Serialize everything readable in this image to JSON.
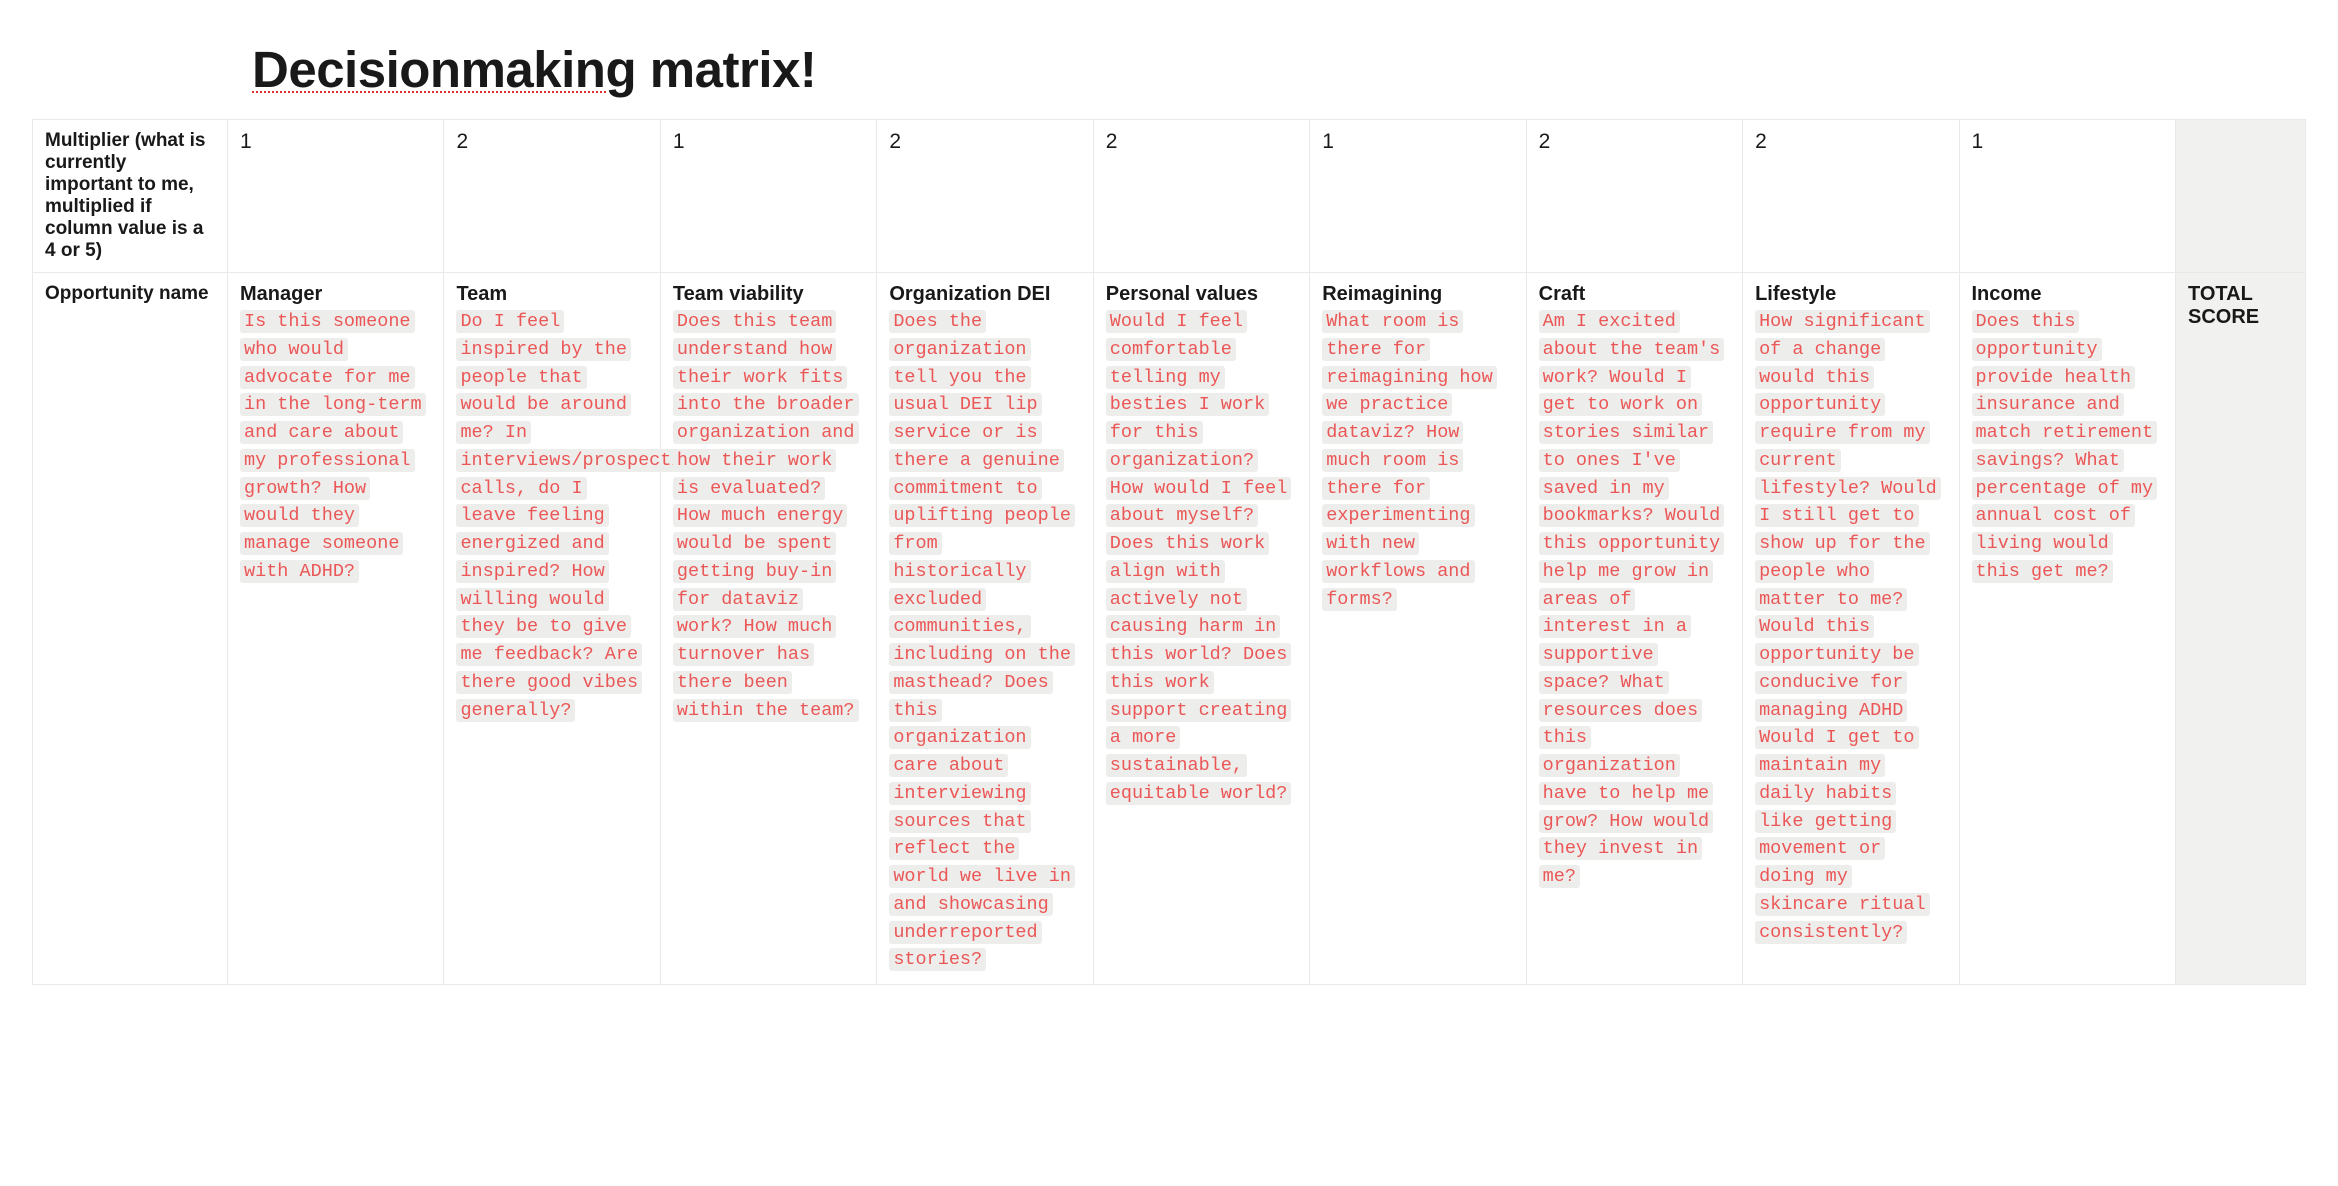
{
  "title_parts": {
    "misspelled": "Decisionmaking",
    "rest": " matrix!"
  },
  "row1_label": "Multiplier (what is currently important to me, multiplied if column value is a 4 or 5)",
  "row2_label": "Opportunity name",
  "total_label": "TOTAL SCORE",
  "columns": [
    {
      "mult": "1",
      "name": "Manager",
      "desc": "Is this someone who would advocate for me in the long-term and care about my professional growth? How would they manage someone with ADHD?"
    },
    {
      "mult": "2",
      "name": "Team",
      "desc": "Do I feel inspired by the people that would be around me? In interviews/prospective calls, do I leave feeling energized and inspired? How willing would they be to give me feedback? Are there good vibes generally?"
    },
    {
      "mult": "1",
      "name": "Team viability",
      "desc": "Does this team understand how their work fits into the broader organization and how their work is evaluated? How much energy would be spent getting buy-in for dataviz work? How much turnover has there been within the team?"
    },
    {
      "mult": "2",
      "name": "Organization DEI",
      "desc": "Does the organization tell you the usual DEI lip service or is there a genuine commitment to uplifting people from historically excluded communities, including on the masthead? Does this organization care about interviewing sources that reflect the world we live in and showcasing underreported stories?"
    },
    {
      "mult": "2",
      "name": "Personal values",
      "desc": "Would I feel comfortable telling my besties I work for this organization? How would I feel about myself? Does this work align with actively not causing harm in this world? Does this work support creating a more sustainable, equitable world?"
    },
    {
      "mult": "1",
      "name": "Reimagining",
      "desc": "What room is there for reimagining how we practice dataviz? How much room is there for experimenting with new workflows and forms?"
    },
    {
      "mult": "2",
      "name": "Craft",
      "desc": "Am I excited about the team's work? Would I get to work on stories similar to ones I've saved in my bookmarks? Would this opportunity help me grow in areas of interest in a supportive space? What resources does this organization have to help me grow? How would they invest in me?"
    },
    {
      "mult": "2",
      "name": "Lifestyle",
      "desc": "How significant of a change would this opportunity require from my current lifestyle? Would I still get to show up for the people who matter to me? Would this opportunity be conducive for managing ADHD Would I get to maintain my daily habits like getting movement or doing my skincare ritual consistently?"
    },
    {
      "mult": "1",
      "name": "Income",
      "desc": "Does this opportunity provide health insurance and match retirement savings? What percentage of my annual cost of living would this get me?"
    }
  ]
}
